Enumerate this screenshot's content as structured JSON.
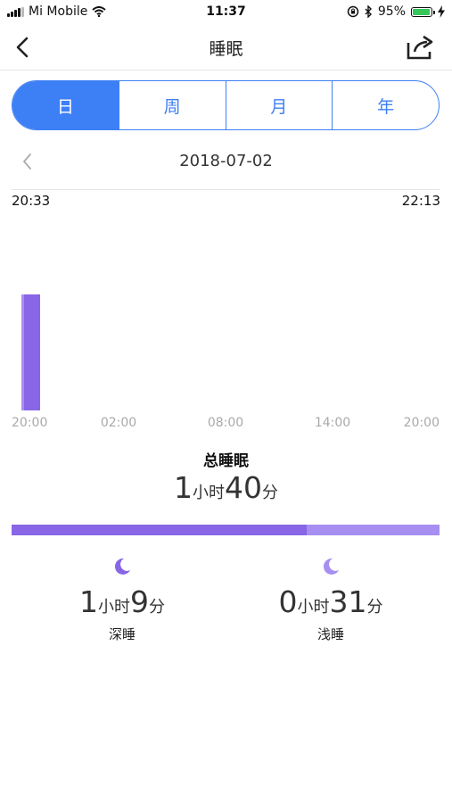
{
  "status_bar": {
    "carrier": "Mi Mobile",
    "time": "11:37",
    "battery": "95%",
    "battery_level": 0.95
  },
  "nav": {
    "title": "睡眠",
    "back_icon": "chevron-left-icon",
    "share_icon": "share-icon"
  },
  "tabs": [
    {
      "label": "日",
      "active": true
    },
    {
      "label": "周",
      "active": false
    },
    {
      "label": "月",
      "active": false
    },
    {
      "label": "年",
      "active": false
    }
  ],
  "date": "2018-07-02",
  "sleep_window": {
    "start": "20:33",
    "end": "22:13"
  },
  "chart_data": {
    "type": "bar",
    "x_ticks": [
      "20:00",
      "02:00",
      "08:00",
      "14:00",
      "20:00"
    ],
    "segments": [
      {
        "stage": "浅睡",
        "start": "20:33",
        "end": "20:43",
        "color": "#a68ff0"
      },
      {
        "stage": "深睡",
        "start": "20:43",
        "end": "21:37",
        "color": "#8866e6"
      }
    ]
  },
  "total": {
    "title": "总睡眠",
    "hours": "1",
    "hour_unit": "小时",
    "minutes": "40",
    "minute_unit": "分"
  },
  "breakdown": [
    {
      "label": "深睡",
      "hours": "1",
      "hour_unit": "小时",
      "minutes": "9",
      "minute_unit": "分",
      "total_minutes": 69,
      "color": "#8866e6"
    },
    {
      "label": "浅睡",
      "hours": "0",
      "hour_unit": "小时",
      "minutes": "31",
      "minute_unit": "分",
      "total_minutes": 31,
      "color": "#a68ff0"
    }
  ],
  "colors": {
    "accent": "#3d7ff5",
    "deep_sleep": "#8866e6",
    "light_sleep": "#a68ff0"
  }
}
